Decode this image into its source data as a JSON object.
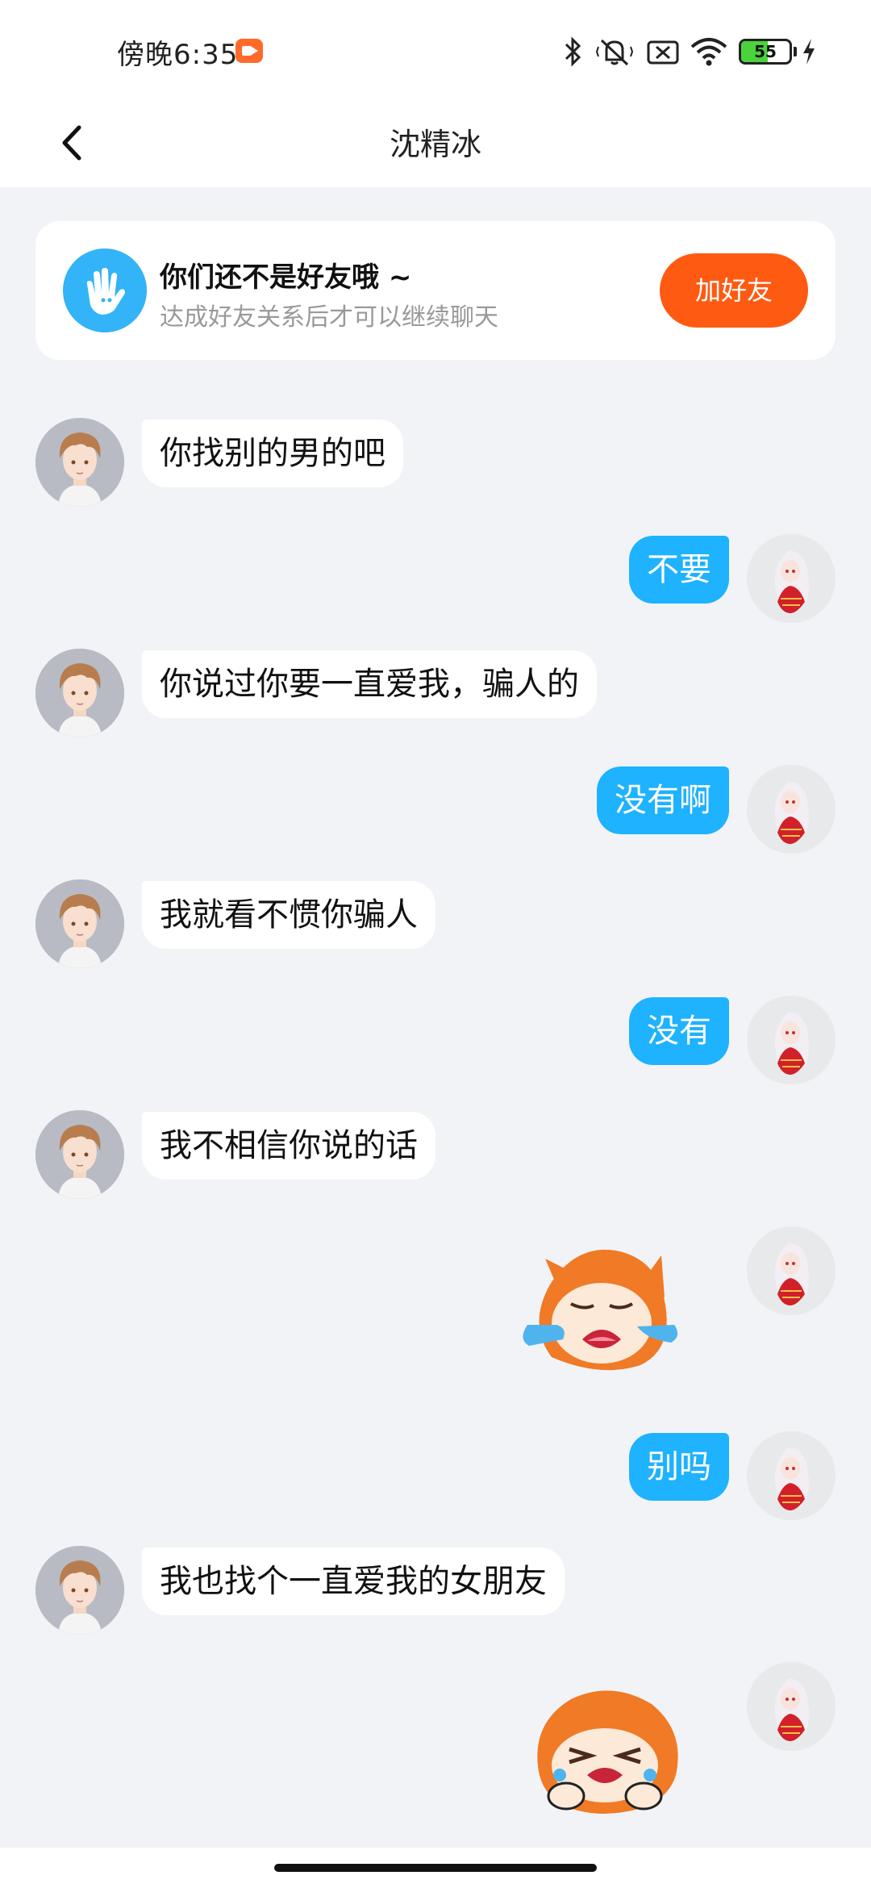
{
  "status_bar": {
    "time": "傍晚6:35",
    "battery_level": 55,
    "battery_text": "55"
  },
  "header": {
    "title": "沈精冰"
  },
  "friend_banner": {
    "title": "你们还不是好友哦 ~",
    "subtitle": "达成好友关系后才可以继续聊天",
    "button_label": "加好友"
  },
  "messages": [
    {
      "side": "in",
      "type": "text",
      "text": "你找别的男的吧"
    },
    {
      "side": "out",
      "type": "text",
      "text": "不要"
    },
    {
      "side": "in",
      "type": "text",
      "text": "你说过你要一直爱我，骗人的"
    },
    {
      "side": "out",
      "type": "text",
      "text": "没有啊"
    },
    {
      "side": "in",
      "type": "text",
      "text": "我就看不惯你骗人"
    },
    {
      "side": "out",
      "type": "text",
      "text": "没有"
    },
    {
      "side": "in",
      "type": "text",
      "text": "我不相信你说的话"
    },
    {
      "side": "out",
      "type": "sticker",
      "icon": "crying-sticker"
    },
    {
      "side": "out",
      "type": "text",
      "text": "别吗"
    },
    {
      "side": "in",
      "type": "text",
      "text": "我也找个一直爱我的女朋友"
    },
    {
      "side": "out",
      "type": "sticker",
      "icon": "crying-sticker"
    }
  ],
  "colors": {
    "outgoing_bubble": "#1eb2ff",
    "add_friend_button": "#ff5a12",
    "background": "#f2f3f7"
  }
}
